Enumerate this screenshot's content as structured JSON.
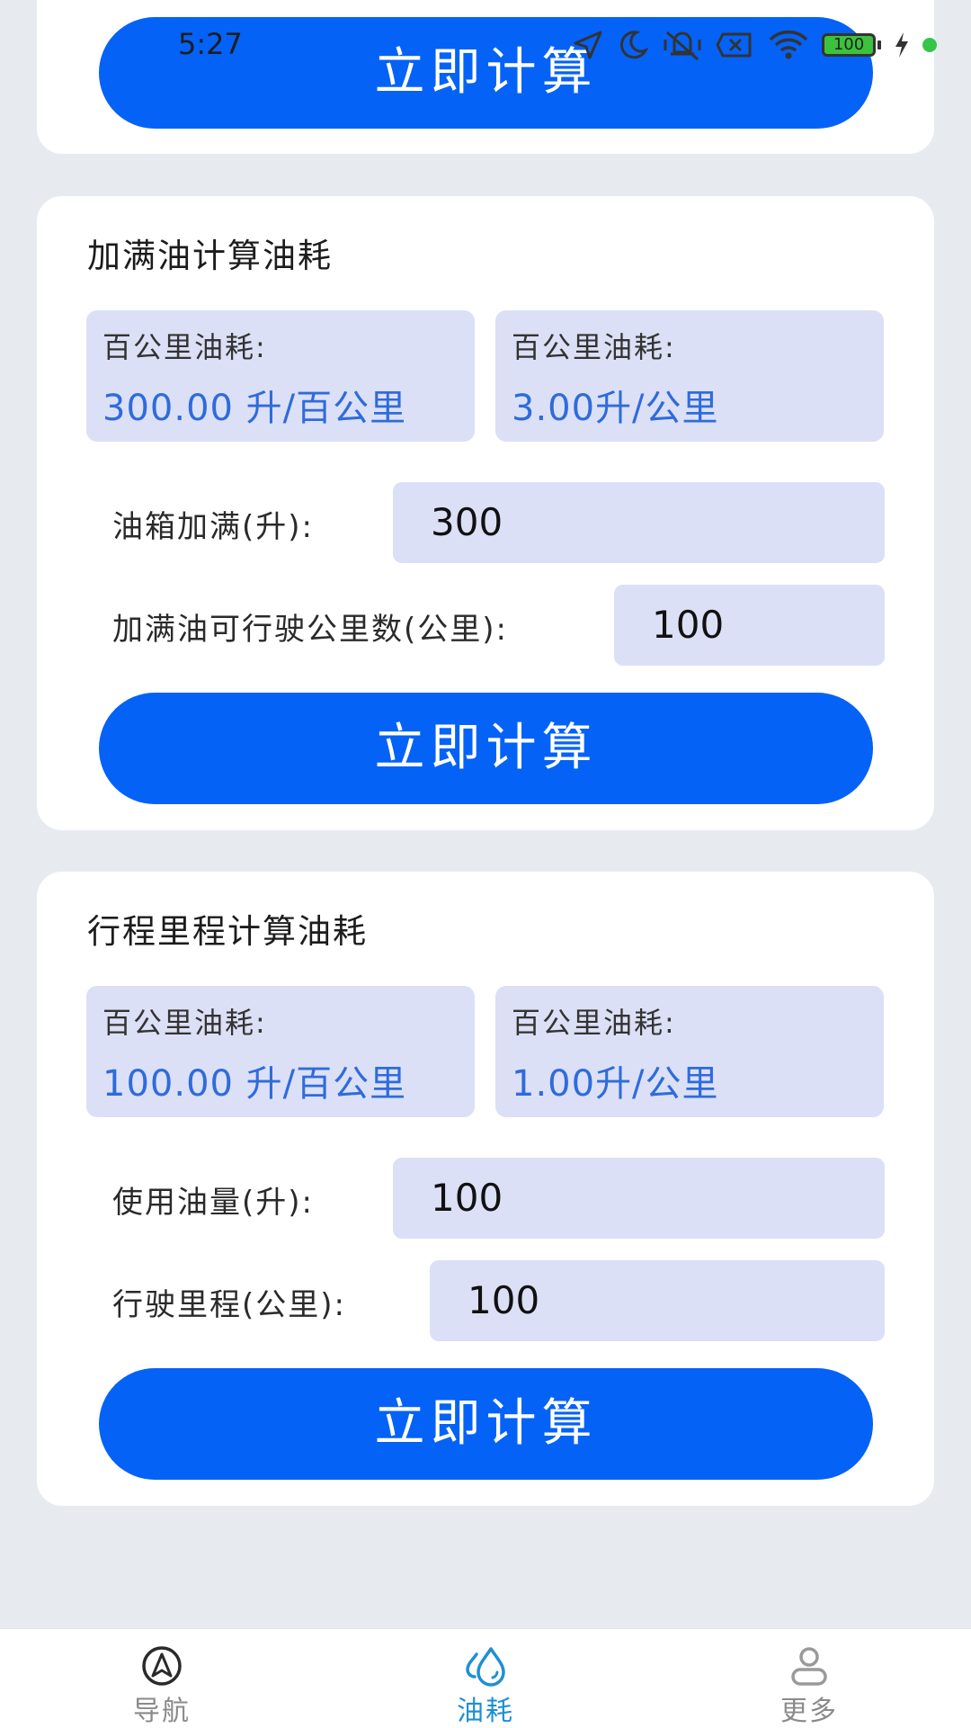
{
  "status_bar": {
    "time": "5:27",
    "battery_level": "100"
  },
  "top_card": {
    "button_label": "立即计算"
  },
  "full_tank_card": {
    "title": "加满油计算油耗",
    "result_left": {
      "label": "百公里油耗:",
      "value": "300.00 升/百公里"
    },
    "result_right": {
      "label": "百公里油耗:",
      "value": "3.00升/公里"
    },
    "tank_label": "油箱加满(升):",
    "tank_value": "300",
    "distance_label": "加满油可行驶公里数(公里):",
    "distance_value": "100",
    "button_label": "立即计算"
  },
  "trip_card": {
    "title": "行程里程计算油耗",
    "result_left": {
      "label": "百公里油耗:",
      "value": "100.00 升/百公里"
    },
    "result_right": {
      "label": "百公里油耗:",
      "value": "1.00升/公里"
    },
    "fuel_used_label": "使用油量(升):",
    "fuel_used_value": "100",
    "mileage_label": "行驶里程(公里):",
    "mileage_value": "100",
    "button_label": "立即计算"
  },
  "bottom_nav": {
    "items": [
      {
        "label": "导航",
        "icon": "navigation-icon",
        "active": false
      },
      {
        "label": "油耗",
        "icon": "fuel-drop-icon",
        "active": true
      },
      {
        "label": "更多",
        "icon": "person-icon",
        "active": false
      }
    ],
    "active_color": "#1E8FD6",
    "inactive_color": "#8A8A8A"
  },
  "colors": {
    "background": "#E7EBF0",
    "card": "#FFFFFF",
    "button": "#0462F7",
    "result_box": "#DBE0F6",
    "result_value": "#2F6BDB"
  }
}
